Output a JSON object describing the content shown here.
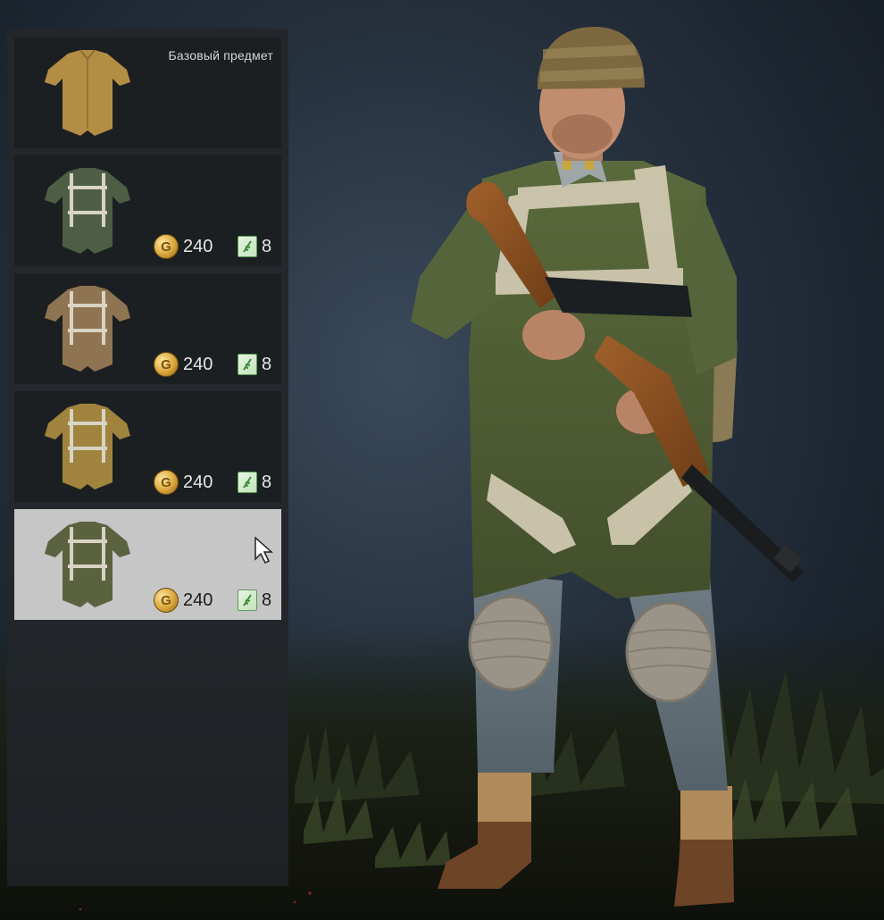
{
  "panel": {
    "items": [
      {
        "label": "Базовый предмет",
        "suit_color": "#b48d45",
        "harness": false,
        "selected": false
      },
      {
        "gold": "240",
        "tickets": "8",
        "suit_color": "#4d5e44",
        "harness": true,
        "selected": false
      },
      {
        "gold": "240",
        "tickets": "8",
        "suit_color": "#8e7450",
        "harness": true,
        "selected": false
      },
      {
        "gold": "240",
        "tickets": "8",
        "suit_color": "#a0843e",
        "harness": true,
        "selected": false
      },
      {
        "gold": "240",
        "tickets": "8",
        "suit_color": "#5a6240",
        "harness": true,
        "selected": true
      }
    ]
  },
  "currency": {
    "gold_icon": "gold-coin-icon",
    "gold_letter": "G",
    "ticket_icon": "ticket-icon"
  },
  "colors": {
    "panel_bg": "#24282c",
    "item_bg": "#1c1f22",
    "item_selected_bg": "#c6c6c6",
    "gold": "#d9a53a",
    "ticket": "#5e9b57"
  }
}
